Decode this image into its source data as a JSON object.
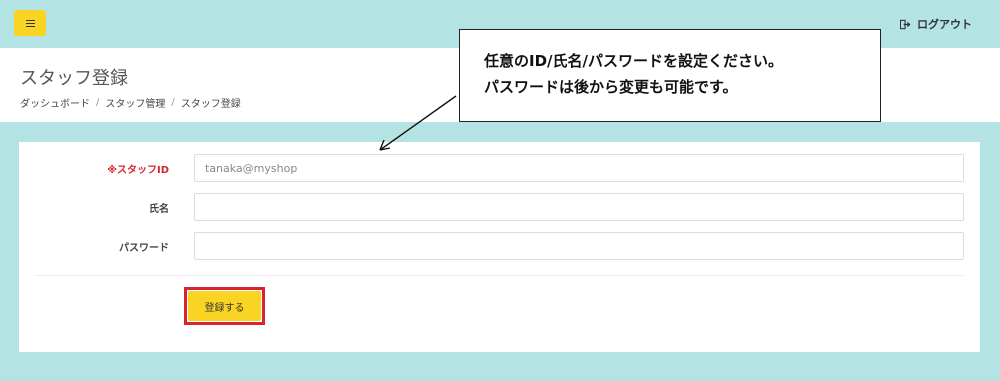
{
  "topbar": {
    "menu_icon": "hamburger-icon",
    "logout_label": "ログアウト",
    "logout_icon": "logout-icon",
    "accent_color": "#f9d423"
  },
  "header": {
    "title": "スタッフ登録",
    "breadcrumb": [
      "ダッシュボード",
      "スタッフ管理",
      "スタッフ登録"
    ],
    "separator": "/"
  },
  "callout": {
    "line1": "任意のID/氏名/パスワードを設定ください。",
    "line2": "パスワードは後から変更も可能です。"
  },
  "form": {
    "fields": [
      {
        "label": "※スタッフID",
        "required": true,
        "placeholder": "tanaka@myshop",
        "value": ""
      },
      {
        "label": "氏名",
        "required": false,
        "placeholder": "",
        "value": ""
      },
      {
        "label": "パスワード",
        "required": false,
        "placeholder": "",
        "value": ""
      }
    ],
    "submit_label": "登録する",
    "required_color": "#d9232e"
  }
}
